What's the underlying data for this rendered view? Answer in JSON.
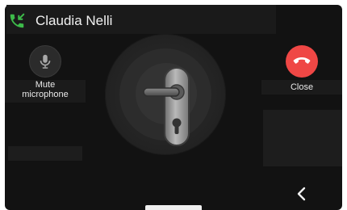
{
  "call": {
    "caller_name": "Claudia Nelli"
  },
  "controls": {
    "mute_label": "Mute\nmicrophone",
    "close_label": "Close"
  },
  "icons": {
    "call": "phone-incoming-icon",
    "mute": "microphone-icon",
    "close": "phone-hangup-icon",
    "door": "door-lock-icon",
    "back": "chevron-left-icon"
  },
  "colors": {
    "background": "#121212",
    "call_icon": "#3dbb4a",
    "close_button": "#ef4745",
    "text": "#f1f1f1"
  }
}
